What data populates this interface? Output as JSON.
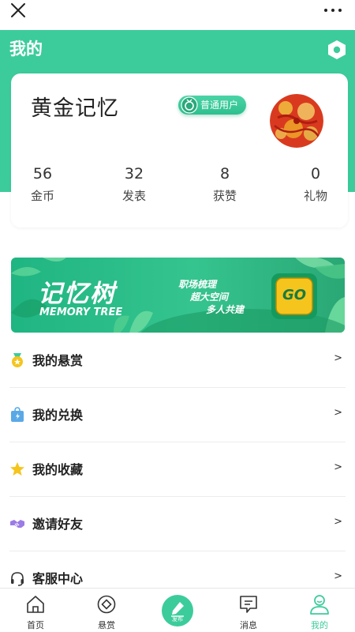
{
  "header": {
    "title": "我的"
  },
  "profile": {
    "name": "黄金记忆",
    "badge": "普通用户",
    "stats": [
      {
        "value": "56",
        "label": "金币"
      },
      {
        "value": "32",
        "label": "发表"
      },
      {
        "value": "8",
        "label": "获赞"
      },
      {
        "value": "0",
        "label": "礼物"
      }
    ]
  },
  "banner": {
    "title": "记忆树",
    "subtitle": "MEMORY TREE",
    "tag1": "职场梳理",
    "tag2": "超大空间",
    "tag3": "多人共建",
    "go": "GO"
  },
  "menu": [
    {
      "label": "我的悬赏",
      "icon": "medal-icon"
    },
    {
      "label": "我的兑换",
      "icon": "exchange-bag-icon"
    },
    {
      "label": "我的收藏",
      "icon": "star-icon"
    },
    {
      "label": "邀请好友",
      "icon": "handshake-icon"
    },
    {
      "label": "客服中心",
      "icon": "headset-icon"
    }
  ],
  "chevron": ">",
  "tabs": [
    {
      "label": "首页"
    },
    {
      "label": "悬赏"
    },
    {
      "label": "发布"
    },
    {
      "label": "消息"
    },
    {
      "label": "我的"
    }
  ],
  "colors": {
    "accent": "#3ccc9c",
    "banner_go": "#f5c51d"
  }
}
